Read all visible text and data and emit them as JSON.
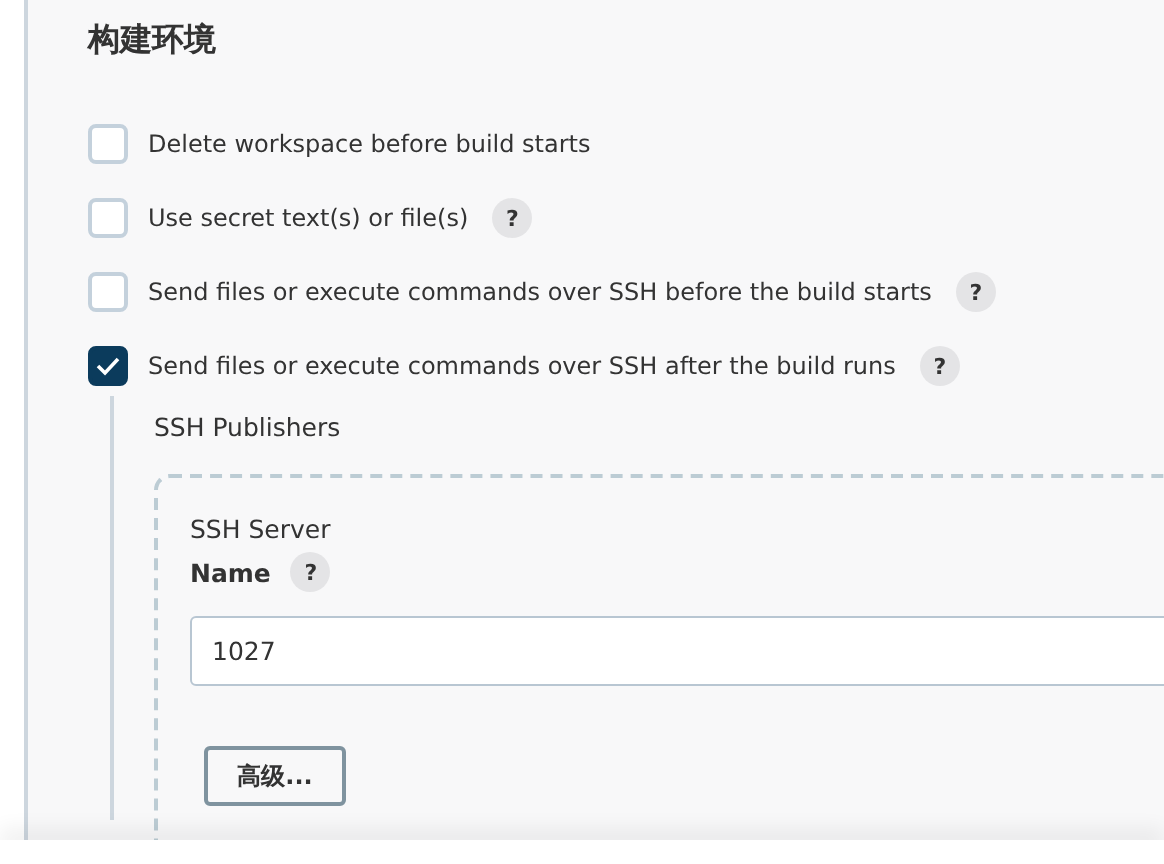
{
  "section": {
    "title": "构建环境"
  },
  "options": [
    {
      "label": "Delete workspace before build starts",
      "checked": false,
      "help": false
    },
    {
      "label": "Use secret text(s) or file(s)",
      "checked": false,
      "help": true
    },
    {
      "label": "Send files or execute commands over SSH before the build starts",
      "checked": false,
      "help": true
    },
    {
      "label": "Send files or execute commands over SSH after the build runs",
      "checked": true,
      "help": true
    }
  ],
  "help_glyph": "?",
  "publishers": {
    "title": "SSH Publishers",
    "server_label": "SSH Server",
    "name_label": "Name",
    "name_value": "1027",
    "advanced_button": "高级..."
  }
}
